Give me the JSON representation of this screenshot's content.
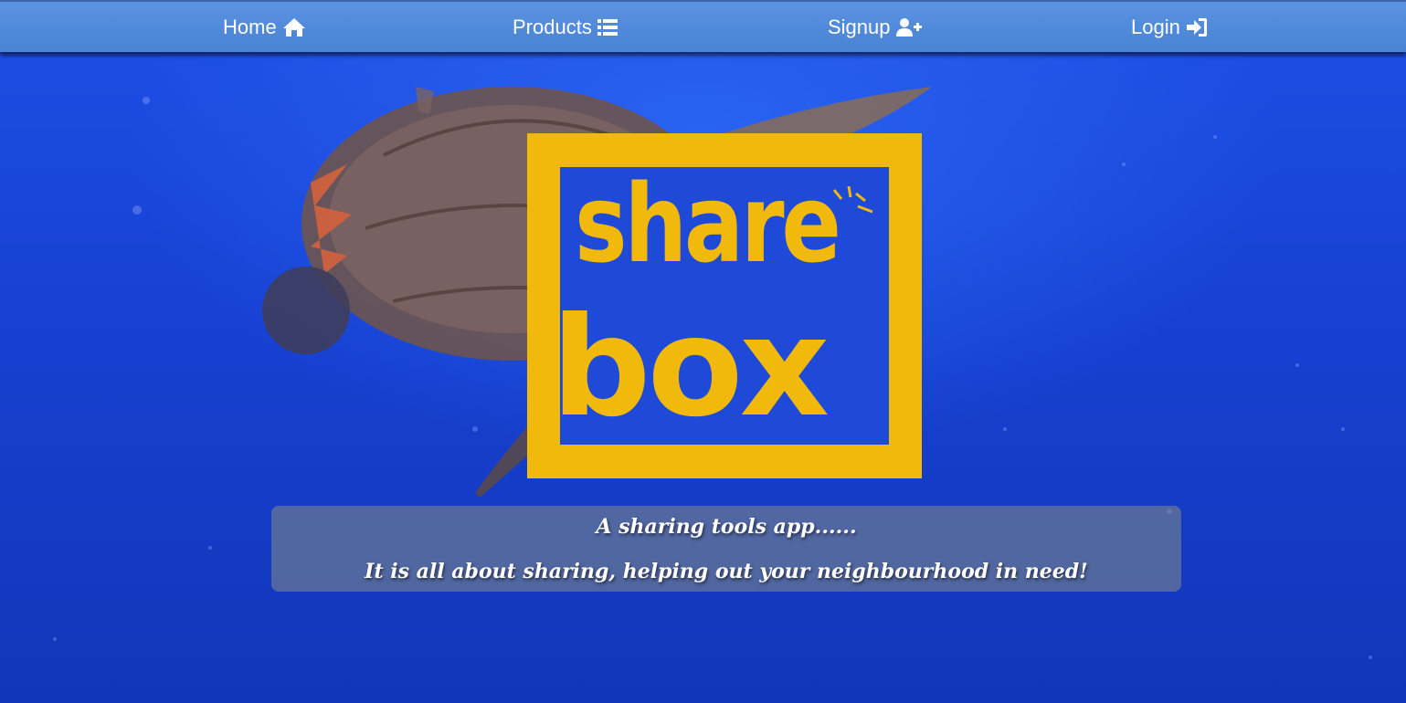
{
  "nav": {
    "items": [
      {
        "label": "Home",
        "icon": "home-icon"
      },
      {
        "label": "Products",
        "icon": "list-icon"
      },
      {
        "label": "Signup",
        "icon": "user-plus-icon"
      },
      {
        "label": "Login",
        "icon": "sign-in-icon"
      }
    ]
  },
  "logo": {
    "line1": "share",
    "line2": "box"
  },
  "tagline": {
    "line1": "A sharing tools app......",
    "line2": "It is all about sharing, helping out your neighbourhood in need!"
  },
  "colors": {
    "navbar": "#4a82d6",
    "logo_yellow": "#f2b90d",
    "ocean_blue": "#1a3fd0"
  }
}
